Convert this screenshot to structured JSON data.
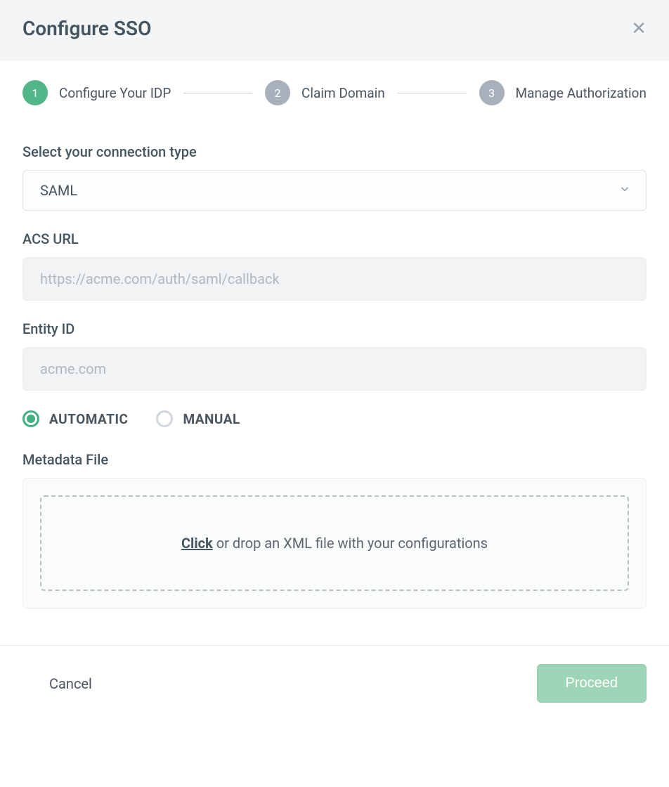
{
  "header": {
    "title": "Configure SSO"
  },
  "steps": [
    {
      "num": "1",
      "label": "Configure Your IDP",
      "active": true
    },
    {
      "num": "2",
      "label": "Claim Domain",
      "active": false
    },
    {
      "num": "3",
      "label": "Manage Authorization",
      "active": false
    }
  ],
  "form": {
    "connection_type": {
      "label": "Select your connection type",
      "value": "SAML"
    },
    "acs_url": {
      "label": "ACS URL",
      "value": "https://acme.com/auth/saml/callback"
    },
    "entity_id": {
      "label": "Entity ID",
      "value": "acme.com"
    },
    "mode": {
      "options": [
        {
          "label": "AUTOMATIC",
          "selected": true
        },
        {
          "label": "MANUAL",
          "selected": false
        }
      ]
    },
    "metadata": {
      "label": "Metadata File",
      "drop_click": "Click",
      "drop_rest": " or drop an XML file with your configurations"
    }
  },
  "footer": {
    "cancel": "Cancel",
    "proceed": "Proceed"
  }
}
